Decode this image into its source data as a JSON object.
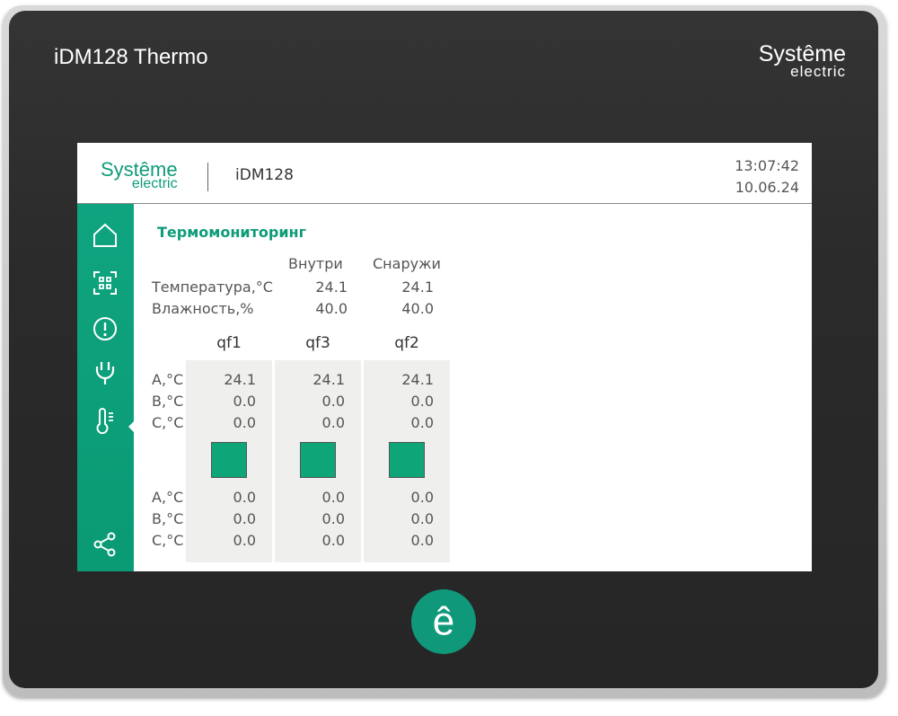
{
  "device": {
    "title": "iDM128 Thermo",
    "brand_top": "Systême",
    "brand_bottom": "electric",
    "logo_glyph": "ê"
  },
  "header": {
    "brand_top": "Systême",
    "brand_bottom": "electric",
    "device_name": "iDM128",
    "time": "13:07:42",
    "date": "10.06.24"
  },
  "sidebar": {
    "items": [
      {
        "name": "home",
        "icon": "home-icon"
      },
      {
        "name": "scan",
        "icon": "scan-icon"
      },
      {
        "name": "alarms",
        "icon": "alert-icon"
      },
      {
        "name": "power",
        "icon": "plug-icon"
      },
      {
        "name": "thermo",
        "icon": "thermometer-icon",
        "active": true
      },
      {
        "name": "network",
        "icon": "share-icon"
      }
    ]
  },
  "main": {
    "title": "Термомониторинг",
    "columns": [
      "Внутри",
      "Снаружи"
    ],
    "rows": [
      {
        "label": "Температура,°С",
        "inside": "24.1",
        "outside": "24.1"
      },
      {
        "label": "Влажность,%",
        "inside": "40.0",
        "outside": "40.0"
      }
    ],
    "phase_labels_top": [
      "A,°C",
      "B,°C",
      "C,°C"
    ],
    "phase_labels_bottom": [
      "A,°C",
      "B,°C",
      "C,°C"
    ],
    "breakers": [
      {
        "name": "qf1",
        "top": [
          "24.1",
          "0.0",
          "0.0"
        ],
        "bottom": [
          "0.0",
          "0.0",
          "0.0"
        ],
        "status_color": "#0ea579"
      },
      {
        "name": "qf3",
        "top": [
          "24.1",
          "0.0",
          "0.0"
        ],
        "bottom": [
          "0.0",
          "0.0",
          "0.0"
        ],
        "status_color": "#0ea579"
      },
      {
        "name": "qf2",
        "top": [
          "24.1",
          "0.0",
          "0.0"
        ],
        "bottom": [
          "0.0",
          "0.0",
          "0.0"
        ],
        "status_color": "#0ea579"
      }
    ]
  },
  "colors": {
    "accent": "#0e9b7a",
    "sidebar": "#0fa47f",
    "bezel": "#2b2b2b"
  }
}
